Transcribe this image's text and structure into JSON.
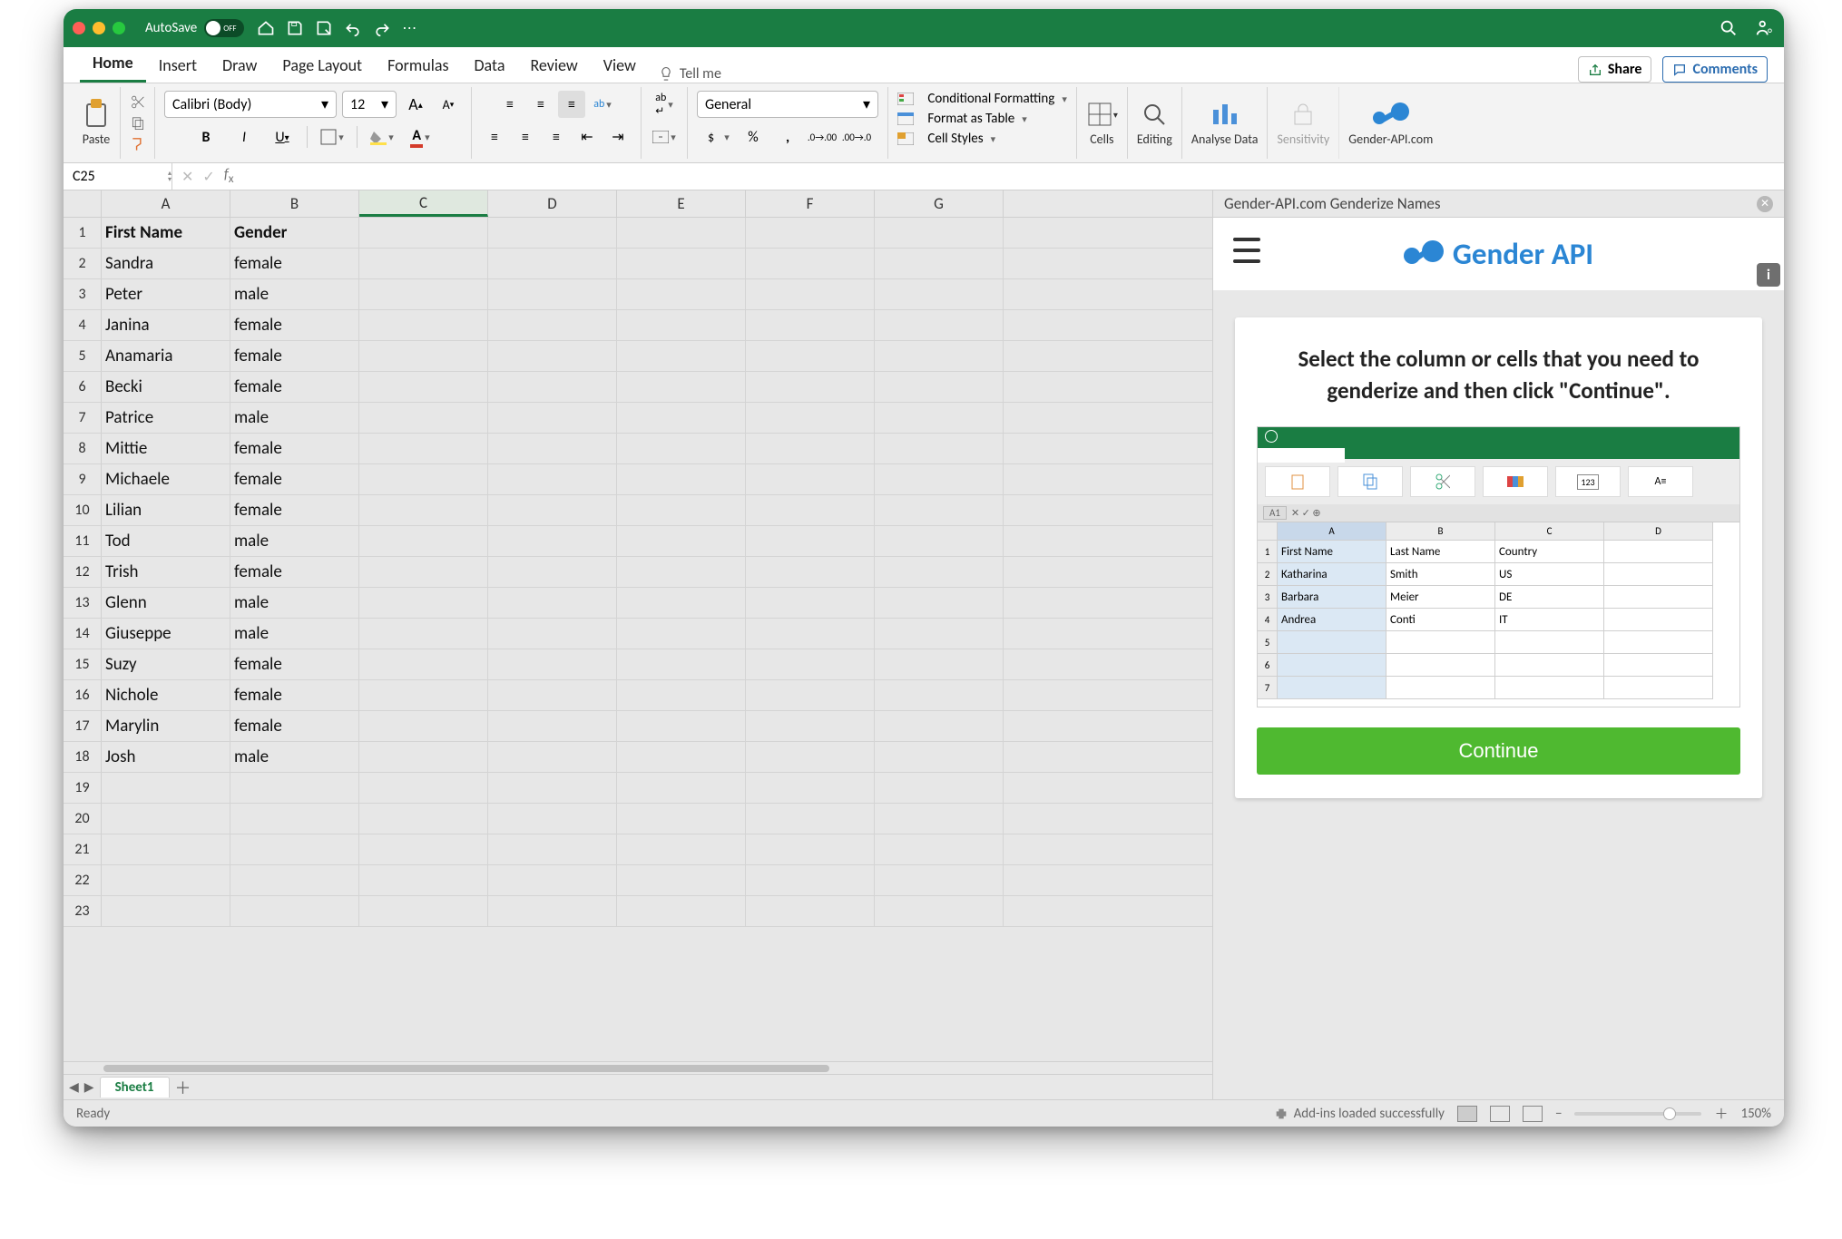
{
  "titlebar": {
    "autosave": "AutoSave",
    "autosave_state": "OFF"
  },
  "tabs": [
    "Home",
    "Insert",
    "Draw",
    "Page Layout",
    "Formulas",
    "Data",
    "Review",
    "View"
  ],
  "tellme": "Tell me",
  "share": "Share",
  "comments": "Comments",
  "ribbon": {
    "paste": "Paste",
    "font": "Calibri (Body)",
    "size": "12",
    "number_format": "General",
    "cond_fmt": "Conditional Formatting",
    "fmt_table": "Format as Table",
    "cell_styles": "Cell Styles",
    "cells": "Cells",
    "editing": "Editing",
    "analyse": "Analyse Data",
    "sensitivity": "Sensitivity",
    "genderapi": "Gender-API.com"
  },
  "namebox": "C25",
  "columns": [
    "A",
    "B",
    "C",
    "D",
    "E",
    "F",
    "G"
  ],
  "sheet_data": {
    "header": [
      "First Name",
      "Gender"
    ],
    "rows": [
      [
        "Sandra",
        "female"
      ],
      [
        "Peter",
        "male"
      ],
      [
        "Janina",
        "female"
      ],
      [
        "Anamaria",
        "female"
      ],
      [
        "Becki",
        "female"
      ],
      [
        "Patrice",
        "male"
      ],
      [
        "Mittie",
        "female"
      ],
      [
        "Michaele",
        "female"
      ],
      [
        "Lilian",
        "female"
      ],
      [
        "Tod",
        "male"
      ],
      [
        "Trish",
        "female"
      ],
      [
        "Glenn",
        "male"
      ],
      [
        "Giuseppe",
        "male"
      ],
      [
        "Suzy",
        "female"
      ],
      [
        "Nichole",
        "female"
      ],
      [
        "Marylin",
        "female"
      ],
      [
        "Josh",
        "male"
      ]
    ],
    "total_rows": 23
  },
  "sheettab": "Sheet1",
  "pane": {
    "title": "Gender-API.com Genderize Names",
    "brand_a": "Gender",
    "brand_b": "API",
    "instr": "Select the column or cells that you need to genderize and then click \"Continue\".",
    "continue": "Continue",
    "example": {
      "header": [
        "First Name",
        "Last Name",
        "Country"
      ],
      "rows": [
        [
          "Katharina",
          "Smith",
          "US"
        ],
        [
          "Barbara",
          "Meier",
          "DE"
        ],
        [
          "Andrea",
          "Conti",
          "IT"
        ]
      ],
      "fx": "A1",
      "cols": [
        "A",
        "B",
        "C",
        "D"
      ]
    }
  },
  "status": {
    "ready": "Ready",
    "addins": "Add-ins loaded successfully",
    "zoom": "150%"
  }
}
